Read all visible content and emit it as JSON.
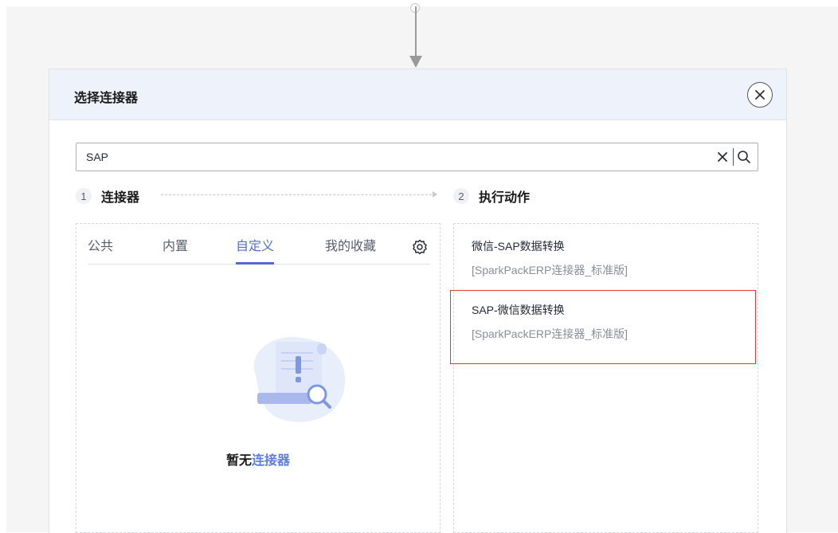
{
  "dialog": {
    "title": "选择连接器"
  },
  "search": {
    "value": "SAP"
  },
  "steps": [
    {
      "num": "1",
      "label": "连接器"
    },
    {
      "num": "2",
      "label": "执行动作"
    }
  ],
  "tabs": [
    {
      "label": "公共",
      "active": false
    },
    {
      "label": "内置",
      "active": false
    },
    {
      "label": "自定义",
      "active": true
    },
    {
      "label": "我的收藏",
      "active": false
    }
  ],
  "empty": {
    "prefix": "暂无",
    "link": "连接器"
  },
  "actions": [
    {
      "title": "微信-SAP数据转换",
      "subtitle": "[SparkPackERP连接器_标准版]"
    },
    {
      "title": "SAP-微信数据转换",
      "subtitle": "[SparkPackERP连接器_标准版]",
      "highlighted": true
    }
  ],
  "colors": {
    "accent": "#526ecc",
    "link": "#5e7ce0",
    "highlight": "#e0353a",
    "header_bg": "#eef2fb"
  },
  "icons": [
    "close-icon",
    "clear-icon",
    "search-icon",
    "gear-icon",
    "empty-state-illustration"
  ]
}
